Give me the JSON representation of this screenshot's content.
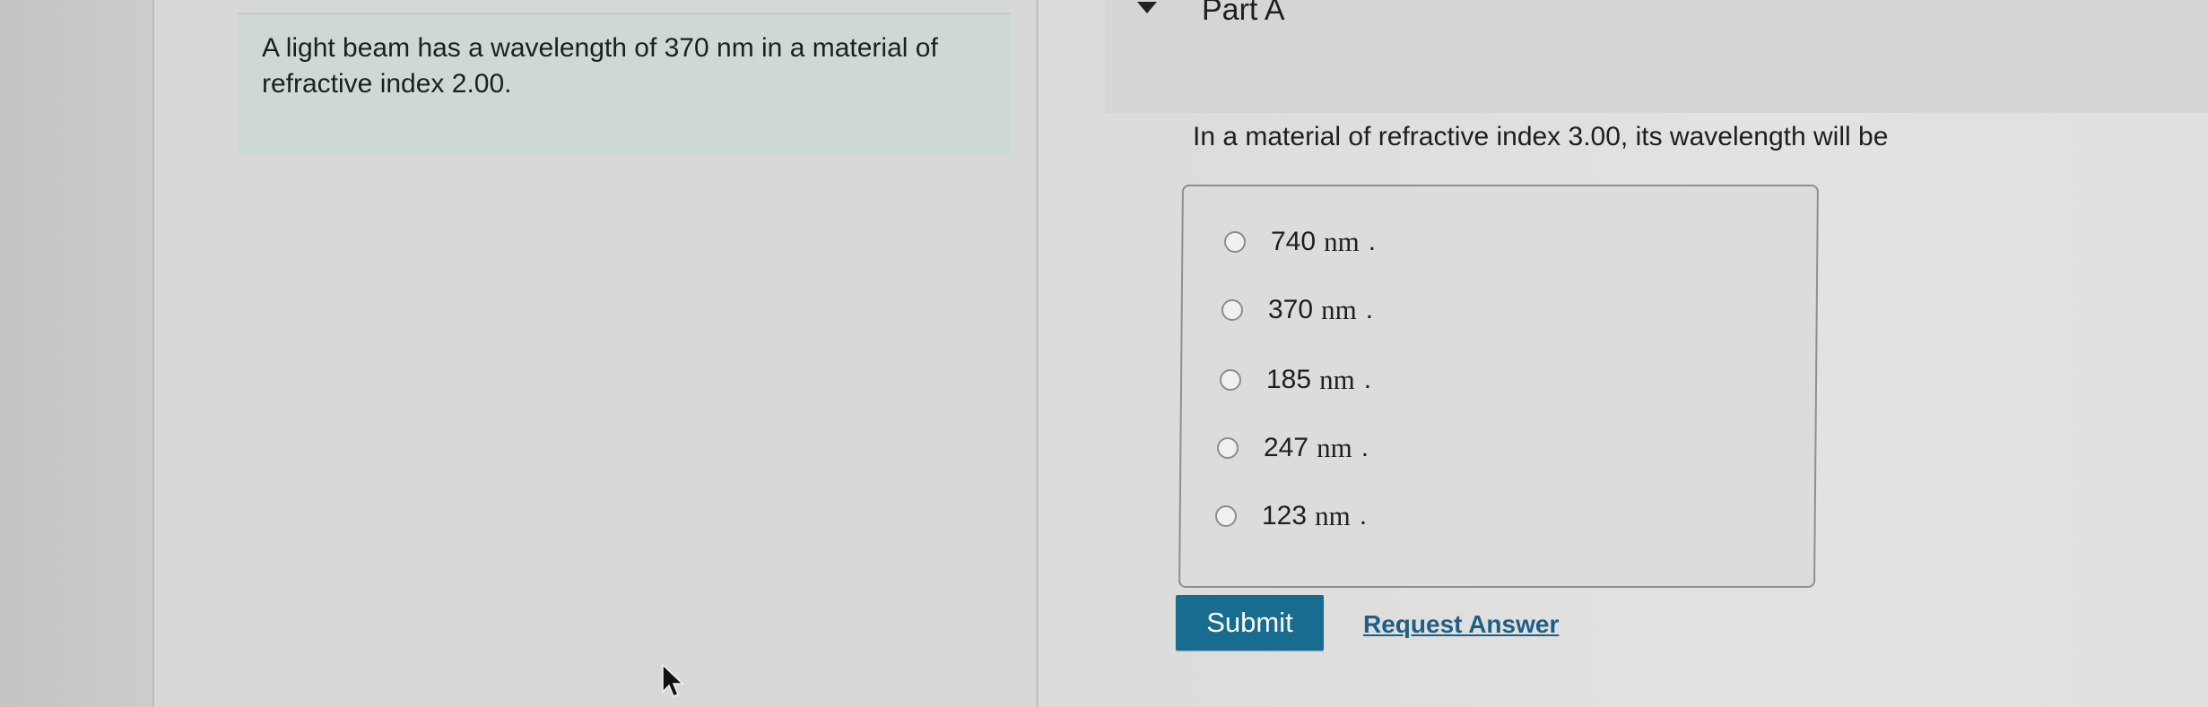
{
  "question": {
    "text": "A light beam has a wavelength of 370 nm in a material of refractive index 2.00."
  },
  "part": {
    "title": "Part A",
    "prompt": "In a material of refractive index 3.00, its wavelength will be"
  },
  "options": [
    {
      "value": "740",
      "unit": "nm",
      "punct": "."
    },
    {
      "value": "370",
      "unit": "nm",
      "punct": "."
    },
    {
      "value": "185",
      "unit": "nm",
      "punct": "."
    },
    {
      "value": "247",
      "unit": "nm",
      "punct": "."
    },
    {
      "value": "123",
      "unit": "nm",
      "punct": "."
    }
  ],
  "actions": {
    "submit_label": "Submit",
    "request_answer_label": "Request Answer"
  },
  "colors": {
    "submit_bg": "#176d8f",
    "link": "#1e5f88",
    "question_bg": "#cfd9d4"
  },
  "icons": {
    "collapse": "caret-down-icon",
    "pointer": "mouse-cursor-icon"
  }
}
